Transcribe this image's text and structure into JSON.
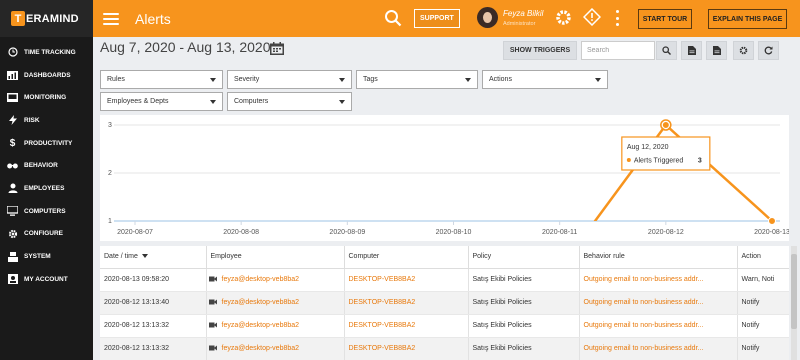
{
  "app": {
    "logo_letter": "T",
    "logo_text": "ERAMIND"
  },
  "sidebar": {
    "items": [
      {
        "label": "TIME TRACKING",
        "icon": "clock-icon"
      },
      {
        "label": "DASHBOARDS",
        "icon": "dashboard-icon"
      },
      {
        "label": "MONITORING",
        "icon": "monitor-icon"
      },
      {
        "label": "RISK",
        "icon": "bolt-icon"
      },
      {
        "label": "PRODUCTIVITY",
        "icon": "dollar-icon"
      },
      {
        "label": "BEHAVIOR",
        "icon": "glasses-icon"
      },
      {
        "label": "EMPLOYEES",
        "icon": "user-icon"
      },
      {
        "label": "COMPUTERS",
        "icon": "computer-icon"
      },
      {
        "label": "CONFIGURE",
        "icon": "gear-icon"
      },
      {
        "label": "SYSTEM",
        "icon": "system-icon"
      },
      {
        "label": "MY ACCOUNT",
        "icon": "account-icon"
      }
    ]
  },
  "header": {
    "title": "Alerts",
    "support_label": "SUPPORT",
    "user_name": "Feyza Bilkil",
    "user_role": "Administrator",
    "start_tour_label": "START TOUR",
    "explain_label": "EXPLAIN THIS PAGE"
  },
  "toolbar": {
    "date_range": "Aug 7, 2020 - Aug 13, 2020",
    "show_triggers_label": "SHOW TRIGGERS",
    "search_placeholder": "Search"
  },
  "filters": {
    "rules": "Rules",
    "severity": "Severity",
    "tags": "Tags",
    "actions": "Actions",
    "employees": "Employees & Depts",
    "computers": "Computers"
  },
  "chart_data": {
    "type": "line",
    "x": [
      "2020-08-07",
      "2020-08-08",
      "2020-08-09",
      "2020-08-10",
      "2020-08-11",
      "2020-08-12",
      "2020-08-13"
    ],
    "series": [
      {
        "name": "Alerts Triggered",
        "values": [
          0,
          0,
          0,
          0,
          0,
          3,
          1
        ]
      }
    ],
    "y_ticks": [
      1,
      2,
      3
    ],
    "ylim": [
      1,
      3
    ],
    "grid": true,
    "tooltip": {
      "date": "Aug 12, 2020",
      "label": "Alerts Triggered",
      "value": "3"
    },
    "colors": {
      "line": "#f7941d",
      "baseline": "#9ec3e6"
    }
  },
  "table": {
    "columns": [
      "Date / time",
      "Employee",
      "Computer",
      "Policy",
      "Behavior rule",
      "Action"
    ],
    "rows": [
      {
        "datetime": "2020-08-13 09:58:20",
        "employee": "feyza@desktop-veb8ba2",
        "computer": "DESKTOP-VEB8BA2",
        "policy": "Satış Ekibi Policies",
        "rule": "Outgoing email to non-business addr...",
        "action": "Warn, Noti"
      },
      {
        "datetime": "2020-08-12 13:13:40",
        "employee": "feyza@desktop-veb8ba2",
        "computer": "DESKTOP-VEB8BA2",
        "policy": "Satış Ekibi Policies",
        "rule": "Outgoing email to non-business addr...",
        "action": "Notify"
      },
      {
        "datetime": "2020-08-12 13:13:32",
        "employee": "feyza@desktop-veb8ba2",
        "computer": "DESKTOP-VEB8BA2",
        "policy": "Satış Ekibi Policies",
        "rule": "Outgoing email to non-business addr...",
        "action": "Notify"
      },
      {
        "datetime": "2020-08-12 13:13:32",
        "employee": "feyza@desktop-veb8ba2",
        "computer": "DESKTOP-VEB8BA2",
        "policy": "Satış Ekibi Policies",
        "rule": "Outgoing email to non-business addr...",
        "action": "Notify"
      }
    ]
  },
  "colors": {
    "brand": "#f7941d",
    "sidebar": "#1a1a1a",
    "link": "#e8790c"
  }
}
